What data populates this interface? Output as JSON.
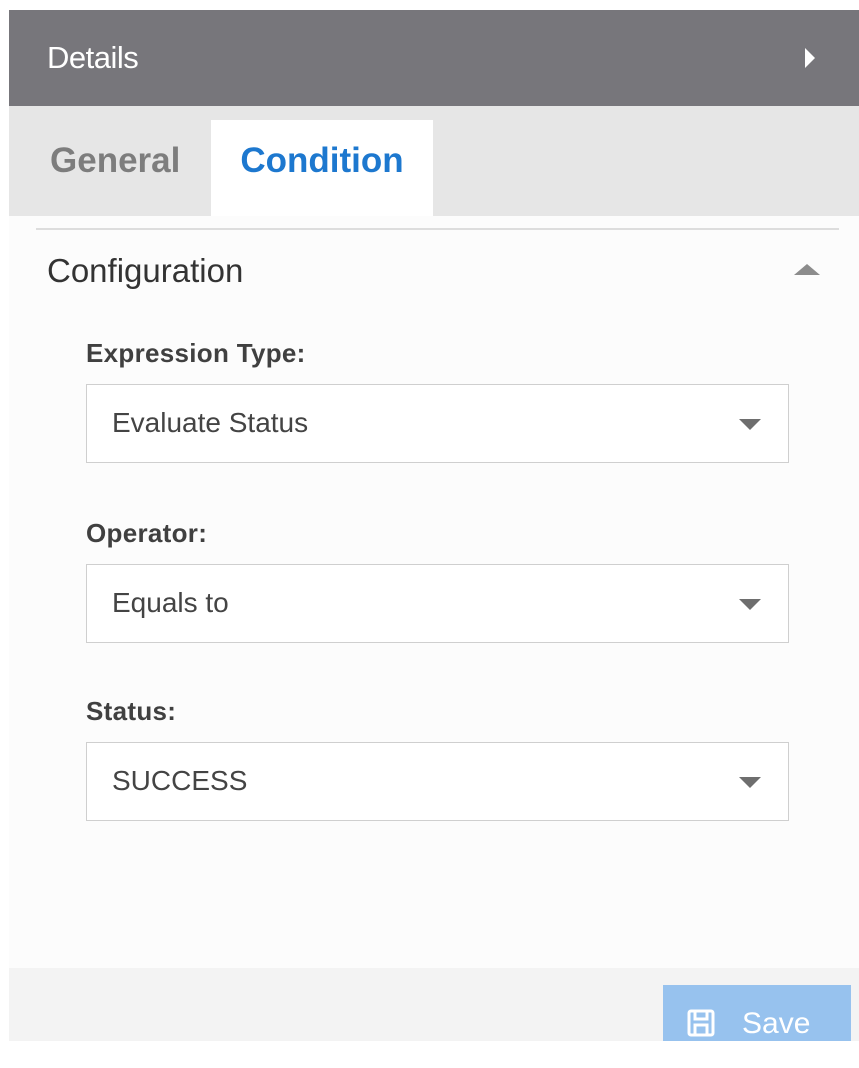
{
  "header": {
    "title": "Details",
    "expand_icon": "chevron-right-icon"
  },
  "tabs": [
    {
      "label": "General",
      "active": false
    },
    {
      "label": "Condition",
      "active": true
    }
  ],
  "section": {
    "title": "Configuration",
    "collapse_icon": "chevron-up-icon",
    "fields": [
      {
        "label": "Expression Type:",
        "value": "Evaluate Status"
      },
      {
        "label": "Operator:",
        "value": "Equals to"
      },
      {
        "label": "Status:",
        "value": "SUCCESS"
      }
    ]
  },
  "footer": {
    "save_label": "Save",
    "save_icon": "save-icon"
  },
  "colors": {
    "header_bg": "#77767b",
    "accent": "#1d78cf",
    "save_button_bg": "#97c2ee"
  }
}
